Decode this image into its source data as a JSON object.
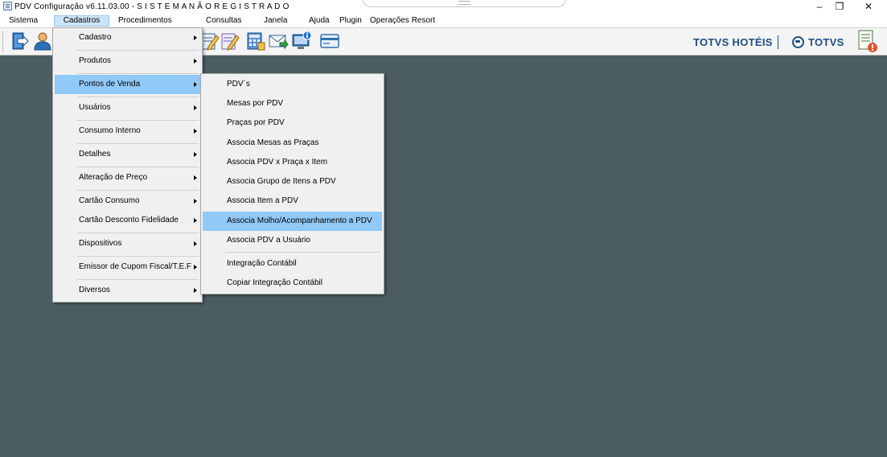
{
  "window": {
    "title": "PDV Configuração v6.11.03.00 - S I S T E M A  N Ã O  R E G I S T R A D O",
    "minimize_glyph": "–",
    "restore_glyph": "❐",
    "close_glyph": "✕"
  },
  "menubar": {
    "items": [
      {
        "label": "Sistema"
      },
      {
        "label": "Cadastros"
      },
      {
        "label": "Procedimentos"
      },
      {
        "label": "Consultas"
      },
      {
        "label": "Janela"
      },
      {
        "label": "Ajuda"
      },
      {
        "label": "Plugin"
      },
      {
        "label": "Operações Resort"
      }
    ]
  },
  "toolbar": {
    "brand": "TOTVS HOTÉIS",
    "logo": "TOTVS",
    "icons": [
      "exit-icon",
      "user-icon",
      "edit-icon",
      "edit-icon",
      "calculator-icon",
      "mail-icon",
      "computer-info-icon",
      "card-icon",
      "document-alert-icon"
    ]
  },
  "cadastros_menu": {
    "items": [
      {
        "label": "Cadastro"
      },
      {
        "label": "Produtos"
      },
      {
        "label": "Pontos de Venda"
      },
      {
        "label": "Usuários"
      },
      {
        "label": "Consumo Interno"
      },
      {
        "label": "Detalhes"
      },
      {
        "label": "Alteração de Preço"
      },
      {
        "label": "Cartão Consumo"
      },
      {
        "label": "Cartão Desconto Fidelidade"
      },
      {
        "label": "Dispositivos"
      },
      {
        "label": "Emissor de Cupom Fiscal/T.E.F"
      },
      {
        "label": "Diversos"
      }
    ]
  },
  "pdv_submenu": {
    "items": [
      {
        "label": "PDV´s"
      },
      {
        "label": "Mesas por PDV"
      },
      {
        "label": "Praças por PDV"
      },
      {
        "label": "Associa Mesas as Praças"
      },
      {
        "label": "Associa PDV x Praça  x Item"
      },
      {
        "label": "Associa Grupo de Itens a PDV"
      },
      {
        "label": "Associa Item a PDV"
      },
      {
        "label": "Associa Molho/Acompanhamento a PDV"
      },
      {
        "label": "Associa PDV a Usuário"
      },
      {
        "label": "Integração Contábil"
      },
      {
        "label": "Copiar Integração Contábil"
      }
    ]
  },
  "colors": {
    "workspace": "#4c5d62",
    "menu_highlight": "#91c9f7",
    "brand": "#1c4e84"
  }
}
